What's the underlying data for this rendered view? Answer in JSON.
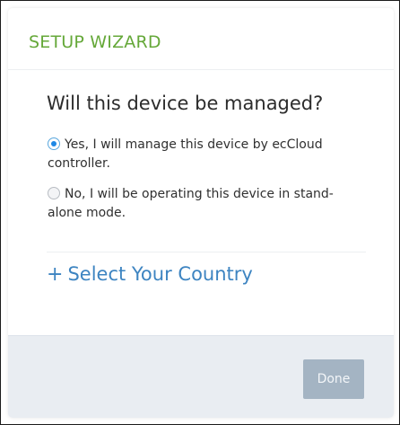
{
  "header": {
    "title": "SETUP WIZARD"
  },
  "question": "Will this device be managed?",
  "options": [
    {
      "label": "Yes, I will manage this device by ecCloud controller.",
      "selected": true
    },
    {
      "label": "No, I will be operating this device in stand-alone mode.",
      "selected": false
    }
  ],
  "country_link": {
    "icon": "plus-icon",
    "label": "Select Your Country"
  },
  "footer": {
    "done_label": "Done",
    "done_disabled": true
  },
  "colors": {
    "header_title": "#65a839",
    "link": "#3d84c1",
    "radio_selected": "#1e88e5",
    "footer_bg": "#e9edf2",
    "done_button_bg": "#a4b4c3"
  }
}
